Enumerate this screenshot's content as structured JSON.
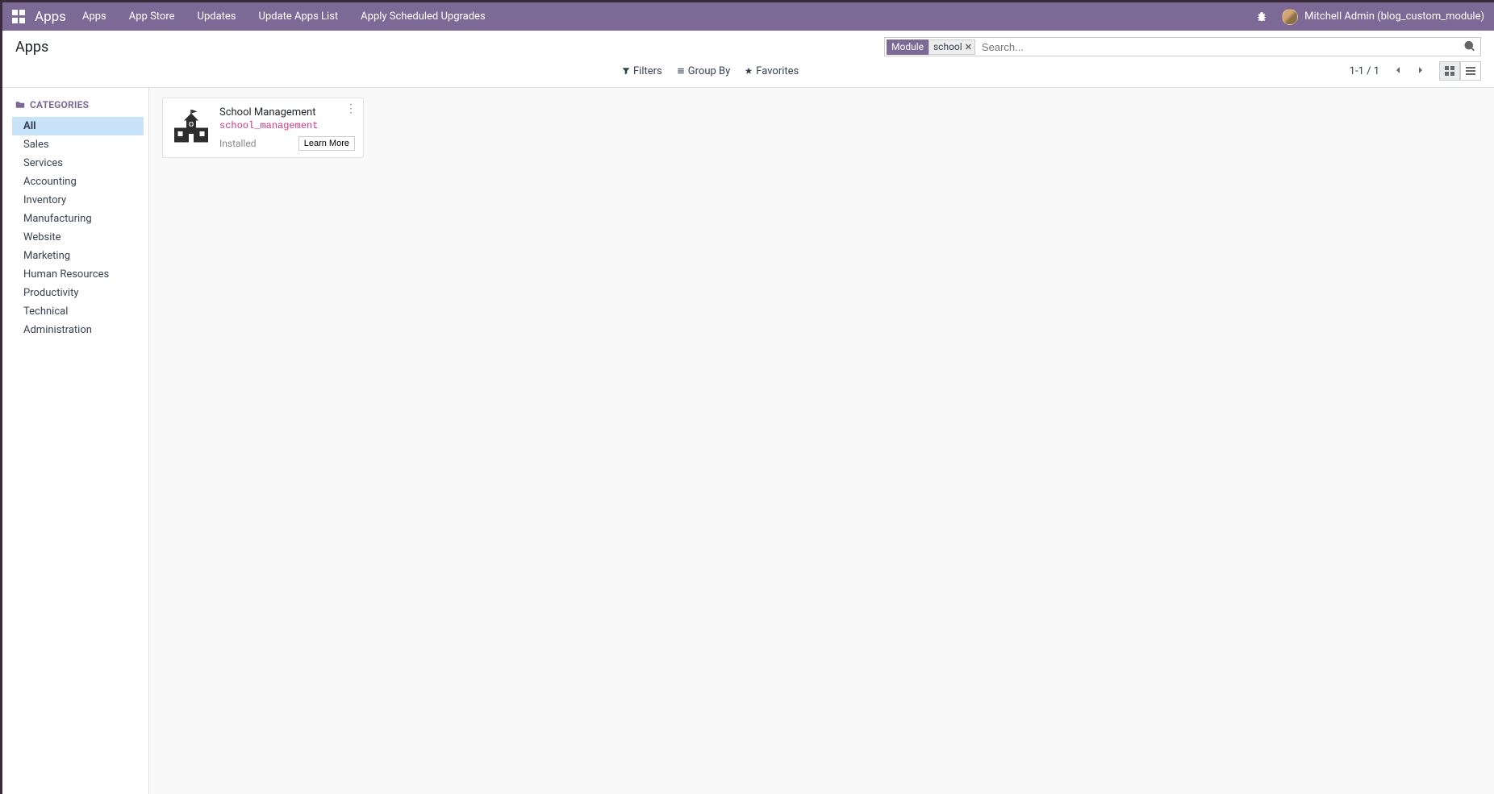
{
  "navbar": {
    "brand": "Apps",
    "menu": [
      "Apps",
      "App Store",
      "Updates",
      "Update Apps List",
      "Apply Scheduled Upgrades"
    ],
    "user": "Mitchell Admin (blog_custom_module)"
  },
  "page": {
    "title": "Apps"
  },
  "search": {
    "facet_label": "Module",
    "facet_value": "school",
    "placeholder": "Search..."
  },
  "toolbar": {
    "filters": "Filters",
    "group_by": "Group By",
    "favorites": "Favorites",
    "pager_text": "1-1 / 1"
  },
  "sidebar": {
    "header": "CATEGORIES",
    "items": [
      "All",
      "Sales",
      "Services",
      "Accounting",
      "Inventory",
      "Manufacturing",
      "Website",
      "Marketing",
      "Human Resources",
      "Productivity",
      "Technical",
      "Administration"
    ],
    "active_index": 0
  },
  "app": {
    "name": "School Management",
    "tech_name": "school_management",
    "status": "Installed",
    "learn_more": "Learn More"
  }
}
